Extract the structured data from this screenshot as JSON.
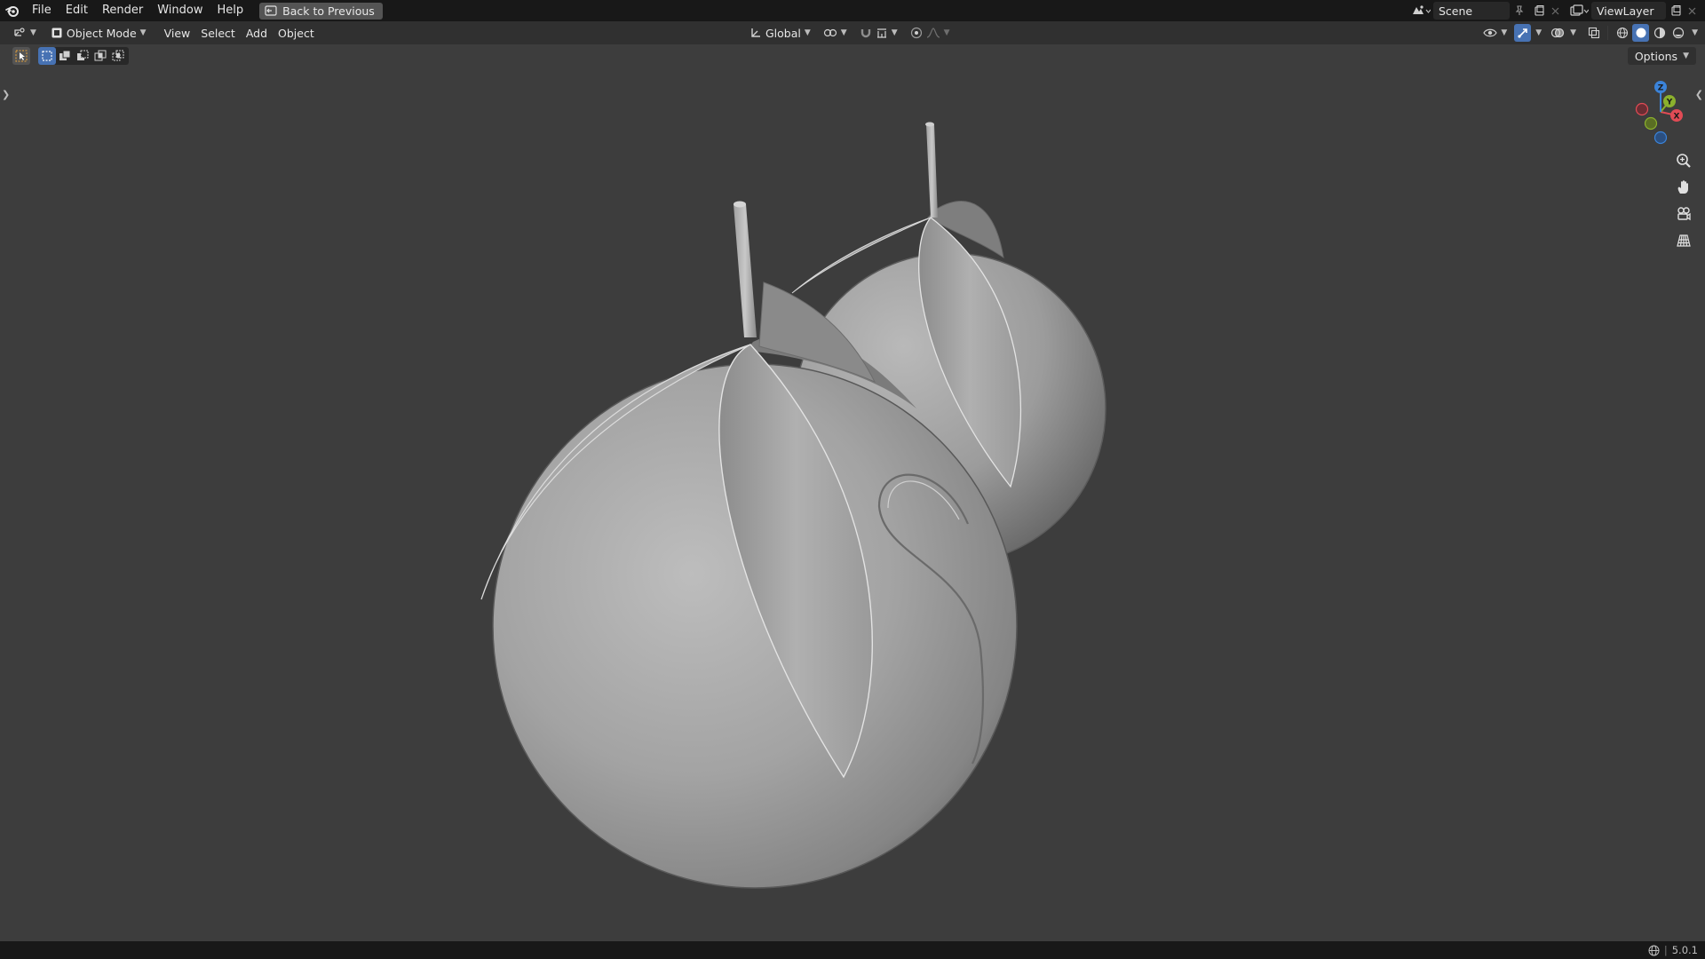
{
  "app": {
    "name": "Blender",
    "version": "5.0.1"
  },
  "menubar": {
    "items": [
      "File",
      "Edit",
      "Render",
      "Window",
      "Help"
    ],
    "back_button": "Back to Previous"
  },
  "scene_selector": {
    "value": "Scene",
    "icon": "scene-icon"
  },
  "viewlayer_selector": {
    "value": "ViewLayer",
    "icon": "render-layer-icon"
  },
  "viewport_header": {
    "editor_type_icon": "3d-viewport-icon",
    "mode": "Object Mode",
    "menus": [
      "View",
      "Select",
      "Add",
      "Object"
    ],
    "transform_orientation": "Global",
    "pivot_icon": "pivot-icon",
    "snap_icon": "magnet-icon",
    "proportional_icon": "proportional-editing-icon",
    "shading_mode": "Solid",
    "shading_modes": [
      "Wireframe",
      "Solid",
      "Material Preview",
      "Rendered"
    ]
  },
  "tool_header": {
    "active_tool": "Select Box",
    "selection_modes": [
      "Set",
      "Extend",
      "Subtract",
      "Difference",
      "Intersect"
    ],
    "active_selection_mode": "Set",
    "options_label": "Options"
  },
  "navigation_gizmo": {
    "axes": [
      "X",
      "Y",
      "Z"
    ],
    "colors": {
      "x": "#e14b55",
      "y": "#8bb02d",
      "z": "#3b83d9"
    }
  },
  "nav_buttons": [
    "zoom-icon",
    "hand-pan-icon",
    "camera-icon",
    "grid-perspective-icon"
  ],
  "theme": {
    "viewport_bg": "#3d3d3d",
    "topbar_bg": "#181818",
    "header_bg": "#303030",
    "accent": "#4772b3",
    "mesh_color": "#a8a8a8"
  }
}
